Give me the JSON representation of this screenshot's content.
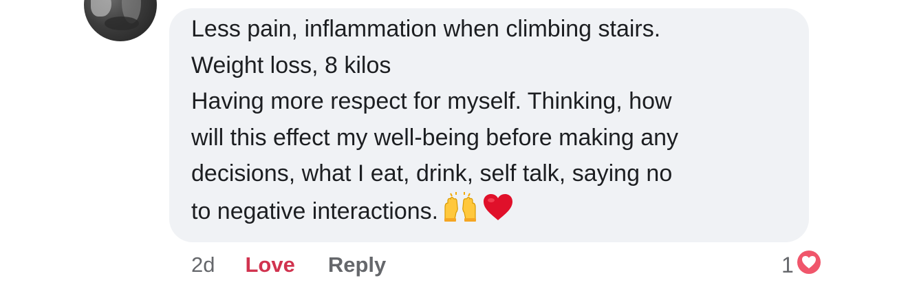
{
  "comment": {
    "lines": [
      "Less pain, inflammation when climbing stairs.",
      "Weight loss, 8 kilos",
      "Having more respect for myself. Thinking, how",
      "will this effect my well-being before making any",
      "decisions, what I eat, drink, self talk, saying no",
      "to negative interactions."
    ],
    "emojis": [
      "raising-hands-icon",
      "red-heart-icon"
    ]
  },
  "actions": {
    "timestamp": "2d",
    "love_label": "Love",
    "reply_label": "Reply"
  },
  "reactions": {
    "count": "1",
    "icon": "love-reaction-icon"
  },
  "colors": {
    "bubble": "#f0f2f5",
    "love": "#d1334f",
    "muted": "#65676b",
    "text": "#1c1e21",
    "heart_red": "#e0102a",
    "reaction_badge": "#f0566b"
  }
}
